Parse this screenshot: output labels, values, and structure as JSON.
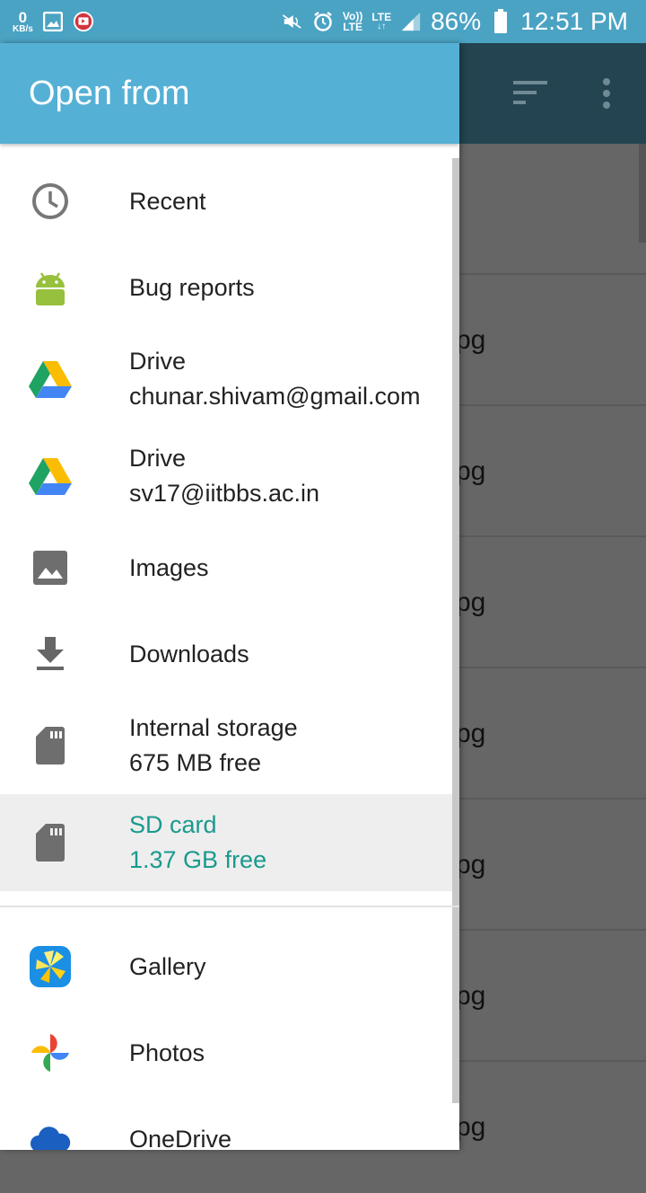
{
  "status_bar": {
    "speed_value": "0",
    "speed_unit": "KB/s",
    "volte_top": "Vo))",
    "volte_bottom": "LTE",
    "lte_label": "LTE",
    "battery": "86%",
    "time": "12:51 PM"
  },
  "drawer": {
    "title": "Open from",
    "items": [
      {
        "icon": "clock-icon",
        "line1": "Recent",
        "line2": ""
      },
      {
        "icon": "android-icon",
        "line1": "Bug reports",
        "line2": ""
      },
      {
        "icon": "drive-icon",
        "line1": "Drive",
        "line2": "chunar.shivam@gmail.com"
      },
      {
        "icon": "drive-icon",
        "line1": "Drive",
        "line2": "sv17@iitbbs.ac.in"
      },
      {
        "icon": "image-icon",
        "line1": "Images",
        "line2": ""
      },
      {
        "icon": "download-icon",
        "line1": "Downloads",
        "line2": ""
      },
      {
        "icon": "sd-card-icon",
        "line1": "Internal storage",
        "line2": "675 MB free"
      },
      {
        "icon": "sd-card-icon",
        "line1": "SD card",
        "line2": "1.37 GB free",
        "selected": true
      },
      {
        "icon": "gallery-icon",
        "line1": "Gallery",
        "line2": ""
      },
      {
        "icon": "photos-icon",
        "line1": "Photos",
        "line2": ""
      },
      {
        "icon": "onedrive-icon",
        "line1": "OneDrive",
        "line2": ""
      }
    ]
  },
  "background_list": {
    "row_suffix": "pg"
  },
  "colors": {
    "header": "#55b0d5",
    "status_bar": "#4ba3c3",
    "selected_text": "#1a9a8d",
    "background_appbar": "#234450"
  }
}
